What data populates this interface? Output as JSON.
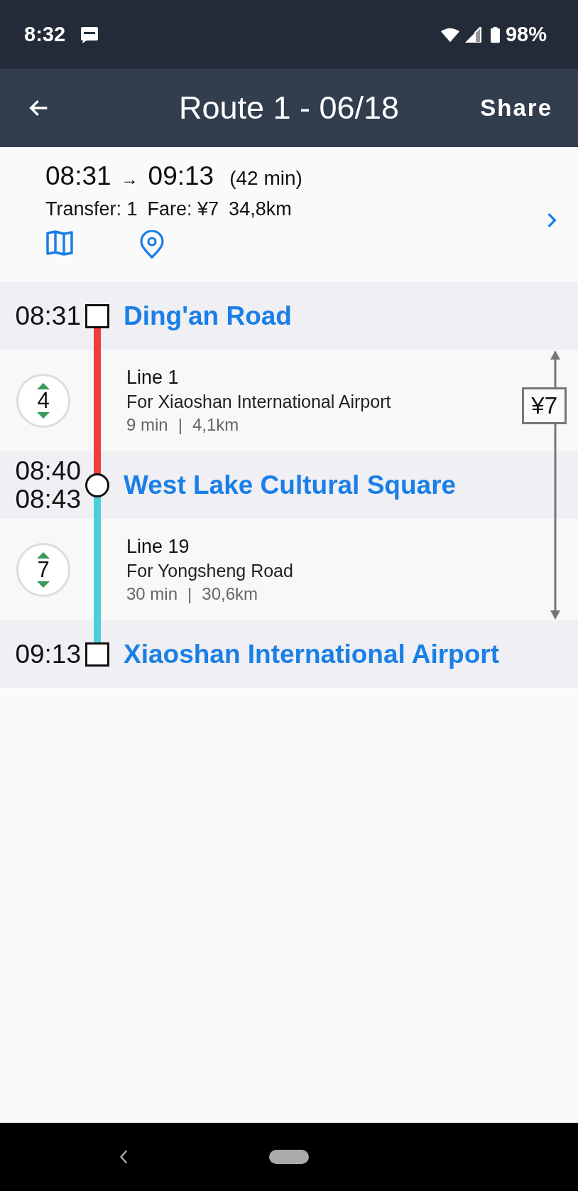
{
  "status_bar": {
    "time": "8:32",
    "battery": "98%"
  },
  "app_bar": {
    "title": "Route 1 - 06/18",
    "action": "Share"
  },
  "summary": {
    "depart": "08:31",
    "arrow": "→",
    "arrive": "09:13",
    "duration": "(42 min)",
    "transfer": "Transfer: 1",
    "fare": "Fare: ¥7",
    "distance": "34,8km"
  },
  "stations": [
    {
      "name": "Ding'an Road",
      "times": [
        "08:31"
      ],
      "kind": "end"
    },
    {
      "name": "West Lake Cultural Square",
      "times": [
        "08:40",
        "08:43"
      ],
      "kind": "transfer"
    },
    {
      "name": "Xiaoshan International Airport",
      "times": [
        "09:13"
      ],
      "kind": "end"
    }
  ],
  "legs": [
    {
      "stops": "4",
      "line": "Line 1",
      "direction": "For Xiaoshan International Airport",
      "time": "9 min",
      "separator": "|",
      "distance": "4,1km",
      "color": "#f23b3b"
    },
    {
      "stops": "7",
      "line": "Line 19",
      "direction": "For Yongsheng Road",
      "time": "30 min",
      "separator": "|",
      "distance": "30,6km",
      "color": "#4ccfdb"
    }
  ],
  "fare_label": "¥7"
}
